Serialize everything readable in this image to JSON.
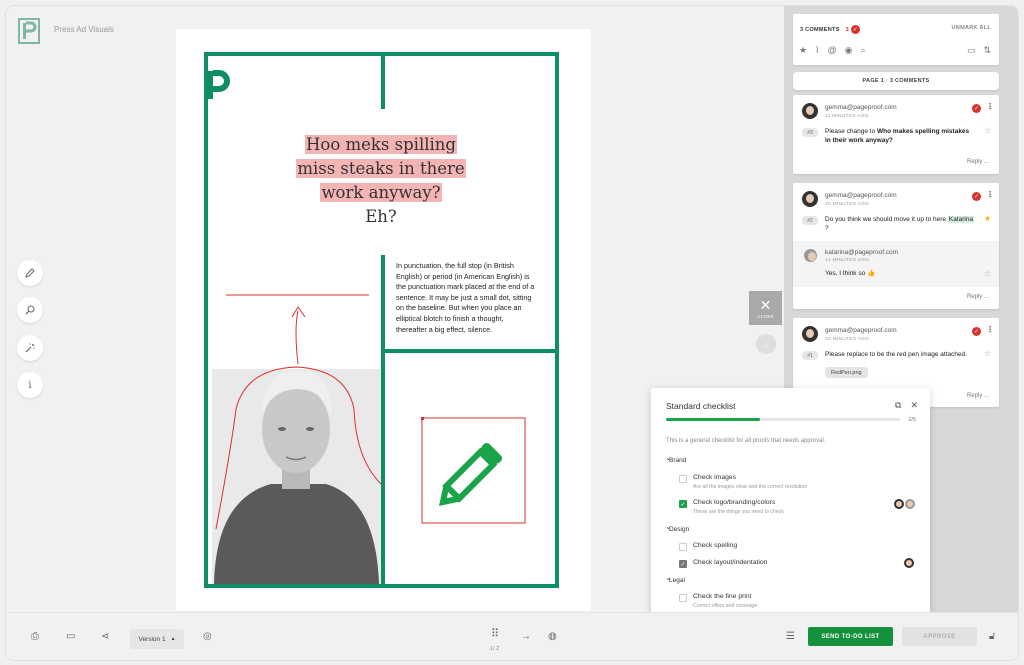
{
  "app": {
    "doc_title": "Press Ad Visuals"
  },
  "document": {
    "headline_lines": [
      "Hoo meks spilling",
      "miss steaks in there",
      "work anyway?"
    ],
    "headline_tail": "Eh?",
    "body": "In punctuation, the full stop (in British English) or period (in American English) is the punctuation mark placed at the end of a sentence. It may be just a small dot, sitting on the baseline. But when you place an elliptical blotch to finish a thought, thereafter a big effect, silence."
  },
  "comments_panel": {
    "count_label": "3 COMMENTS",
    "resolved_count": "3",
    "unmark_label": "UNMARK ALL",
    "page_label": "PAGE 1 · 3 COMMENTS",
    "comments": [
      {
        "email": "gemma@pageproof.com",
        "time": "11 MINUTES AGO",
        "num": "#3",
        "text_pre": "Please change to ",
        "text_bold": "Who makes spelling mistakes in their work anyway?",
        "reply": "Reply ..."
      },
      {
        "email": "gemma@pageproof.com",
        "time": "16 MINUTES AGO",
        "num": "#2",
        "text_pre": "Do you think we should move it up to here ",
        "mention": "Katarina",
        "text_post": "?",
        "reply_email": "katarina@pageproof.com",
        "reply_time": "14 MINUTES AGO",
        "reply_text": "Yes, I think so 👍",
        "reply": "Reply ..."
      },
      {
        "email": "gemma@pageproof.com",
        "time": "20 MINUTES AGO",
        "num": "#1",
        "text": "Please replace to be the red pen image attached.",
        "attachment": "RedPen.png",
        "reply": "Reply ..."
      }
    ]
  },
  "close_label": "CLOSE",
  "checklist": {
    "title": "Standard checklist",
    "progress_text": "2/5",
    "progress_value": 0.4,
    "description": "This is a general checklist for all proofs that needs approval.",
    "sections": [
      {
        "name": "Brand",
        "items": [
          {
            "label": "Check images",
            "sub": "Are all the images clear and the correct resolution",
            "checked": false
          },
          {
            "label": "Check logo/branding/colors",
            "sub": "These are the things you need to check",
            "checked": true
          }
        ]
      },
      {
        "name": "Design",
        "items": [
          {
            "label": "Check spelling",
            "checked": false
          },
          {
            "label": "Check layout/indentation",
            "checked": true
          }
        ]
      },
      {
        "name": "Legal",
        "items": [
          {
            "label": "Check the fine print",
            "sub": "Correct offers and coverage",
            "checked": false
          }
        ]
      }
    ]
  },
  "bottom": {
    "version_label": "Version 1",
    "pager": "1/ 2",
    "send_label": "SEND TO-DO LIST",
    "approve_label": "APPROVE"
  },
  "colors": {
    "brand_green": "#0e8e63",
    "accent_green": "#1aa34a",
    "red": "#d9302c",
    "highlight": "#f5b4b4"
  }
}
